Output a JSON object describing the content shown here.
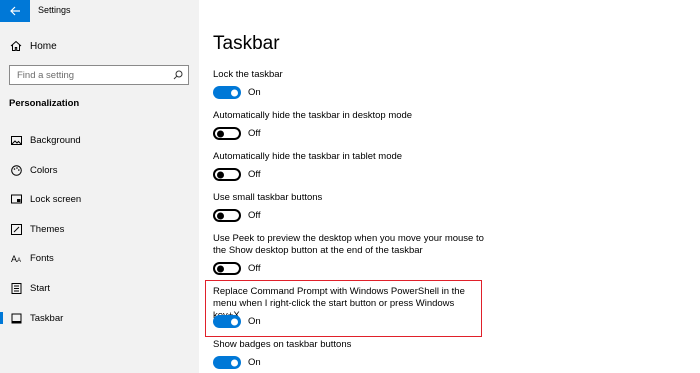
{
  "window": {
    "title": "Settings"
  },
  "sidebar": {
    "home_label": "Home",
    "search_placeholder": "Find a setting",
    "section_title": "Personalization",
    "items": [
      {
        "label": "Background",
        "icon": "picture-icon"
      },
      {
        "label": "Colors",
        "icon": "palette-icon"
      },
      {
        "label": "Lock screen",
        "icon": "lock-screen-icon"
      },
      {
        "label": "Themes",
        "icon": "brush-icon"
      },
      {
        "label": "Fonts",
        "icon": "font-icon"
      },
      {
        "label": "Start",
        "icon": "start-icon"
      },
      {
        "label": "Taskbar",
        "icon": "taskbar-icon",
        "active": true
      }
    ]
  },
  "main": {
    "title": "Taskbar",
    "settings": [
      {
        "label": "Lock the taskbar",
        "state": "On",
        "on": true
      },
      {
        "label": "Automatically hide the taskbar in desktop mode",
        "state": "Off",
        "on": false
      },
      {
        "label": "Automatically hide the taskbar in tablet mode",
        "state": "Off",
        "on": false
      },
      {
        "label": "Use small taskbar buttons",
        "state": "Off",
        "on": false
      },
      {
        "label": "Use Peek to preview the desktop when you move your mouse to the Show desktop button at the end of the taskbar",
        "state": "Off",
        "on": false
      },
      {
        "label": "Replace Command Prompt with Windows PowerShell in the menu when I right-click the start button or press Windows key+X",
        "state": "On",
        "on": true
      },
      {
        "label": "Show badges on taskbar buttons",
        "state": "On",
        "on": true
      }
    ]
  },
  "colors": {
    "accent": "#0078d7",
    "highlight_border": "#e0202a"
  }
}
